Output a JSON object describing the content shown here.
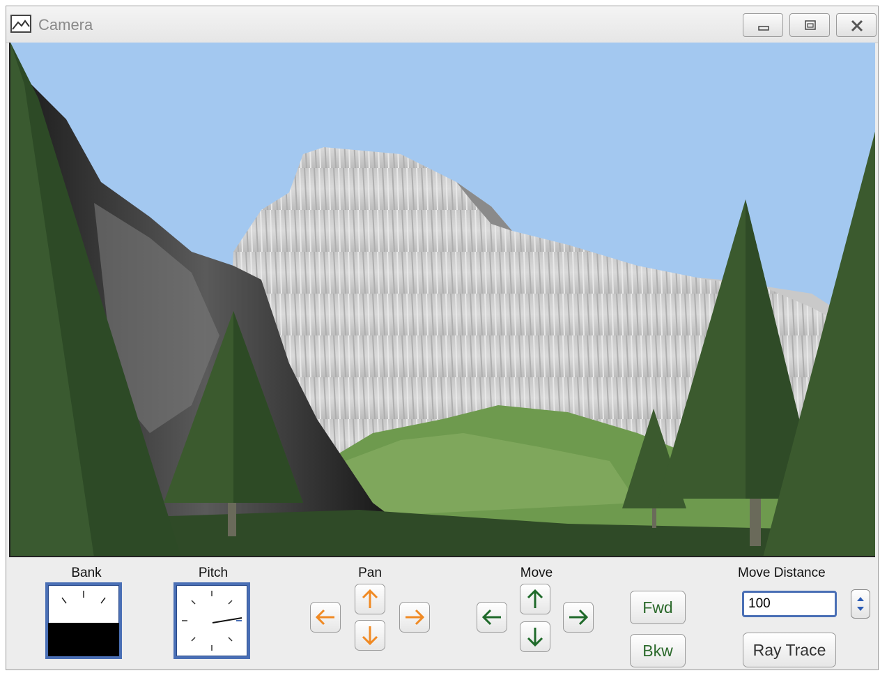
{
  "window": {
    "title": "Camera",
    "icon": "landscape-image-icon",
    "controls": [
      "minimize-icon",
      "restore-icon",
      "close-icon"
    ]
  },
  "scene": {
    "sky_color": "#a3c8f0",
    "ground_color": "#2f4a27",
    "tree_color": "#3b5a2e"
  },
  "controls": {
    "bank": {
      "label": "Bank"
    },
    "pitch": {
      "label": "Pitch"
    },
    "pan": {
      "label": "Pan",
      "color": "#f08a24"
    },
    "move": {
      "label": "Move",
      "color": "#1f6a2a"
    },
    "fwd_label": "Fwd",
    "bkw_label": "Bkw",
    "move_distance": {
      "label": "Move Distance",
      "value": "100"
    },
    "ray_trace_label": "Ray Trace"
  }
}
